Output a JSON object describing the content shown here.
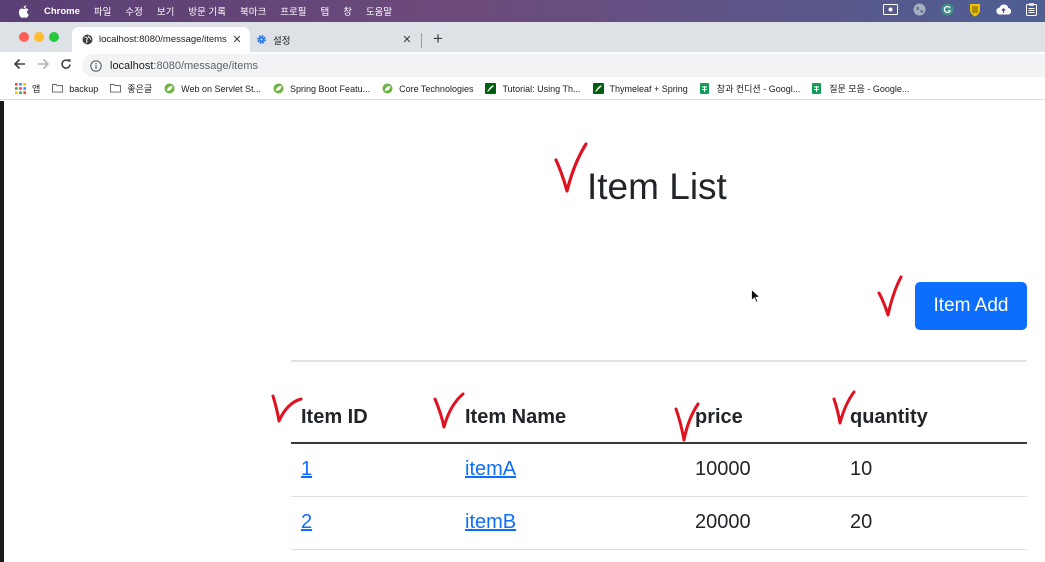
{
  "menubar": {
    "app": "Chrome",
    "items": [
      "파일",
      "수정",
      "보기",
      "방문 기록",
      "북마크",
      "프로필",
      "탭",
      "창",
      "도움말"
    ]
  },
  "tabs": [
    {
      "title": "localhost:8080/message/items",
      "icon": "globe-icon",
      "active": true
    },
    {
      "title": "설정",
      "icon": "gear-icon",
      "active": false
    }
  ],
  "toolbar": {
    "url_host": "localhost",
    "url_path": ":8080/message/items"
  },
  "bookmarks": {
    "items": [
      {
        "label": "앱",
        "icon": "apps-grid-icon"
      },
      {
        "label": "backup",
        "icon": "folder-icon"
      },
      {
        "label": "좋은글",
        "icon": "folder-icon"
      },
      {
        "label": "Web on Servlet St...",
        "icon": "spring-leaf-icon"
      },
      {
        "label": "Spring Boot Featu...",
        "icon": "spring-leaf-icon"
      },
      {
        "label": "Core Technologies",
        "icon": "spring-leaf-icon"
      },
      {
        "label": "Tutorial: Using Th...",
        "icon": "thymeleaf-icon"
      },
      {
        "label": "Thymeleaf + Spring",
        "icon": "thymeleaf-icon"
      },
      {
        "label": "참과 컨디션 - Googl...",
        "icon": "google-sheets-icon"
      },
      {
        "label": "질문 모음 - Google...",
        "icon": "google-sheets-icon"
      }
    ]
  },
  "page": {
    "title": "Item List",
    "add_button": "Item Add"
  },
  "items": {
    "headers": [
      "Item ID",
      "Item Name",
      "price",
      "quantity"
    ],
    "rows": [
      {
        "id": "1",
        "name": "itemA",
        "price": "10000",
        "quantity": "10"
      },
      {
        "id": "2",
        "name": "itemB",
        "price": "20000",
        "quantity": "20"
      }
    ]
  },
  "colors": {
    "primary": "#0d6efd",
    "annotation": "#e0121f",
    "text": "#212529"
  }
}
